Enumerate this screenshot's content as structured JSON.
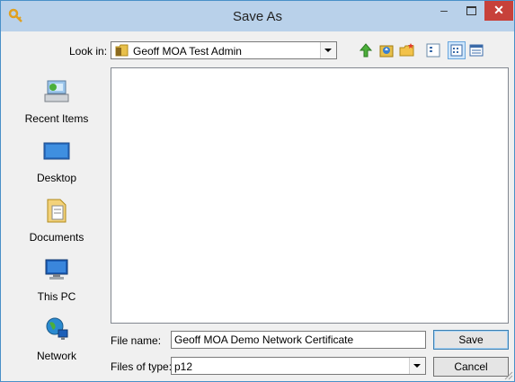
{
  "window": {
    "title": "Save As",
    "minimize_glyph": "–",
    "close_glyph": "✕"
  },
  "toolbar": {
    "look_in_label": "Look in:",
    "look_in_value": "Geoff MOA Test Admin",
    "buttons": [
      "back-icon",
      "up-folder-icon",
      "new-folder-icon",
      "view-menu-icon",
      "list-view-icon",
      "details-view-icon"
    ]
  },
  "places": [
    {
      "label": "Recent Items",
      "icon": "recent-items-icon"
    },
    {
      "label": "Desktop",
      "icon": "desktop-icon"
    },
    {
      "label": "Documents",
      "icon": "documents-icon"
    },
    {
      "label": "This PC",
      "icon": "this-pc-icon"
    },
    {
      "label": "Network",
      "icon": "network-icon"
    }
  ],
  "form": {
    "file_name_label": "File name:",
    "file_name_value": "Geoff MOA Demo Network Certificate",
    "files_of_type_label": "Files of type:",
    "files_of_type_value": "p12"
  },
  "buttons": {
    "save": "Save",
    "cancel": "Cancel"
  },
  "colors": {
    "titlebar": "#b9d1ea",
    "close_button": "#c7413a",
    "window_border": "#4a90c8"
  }
}
